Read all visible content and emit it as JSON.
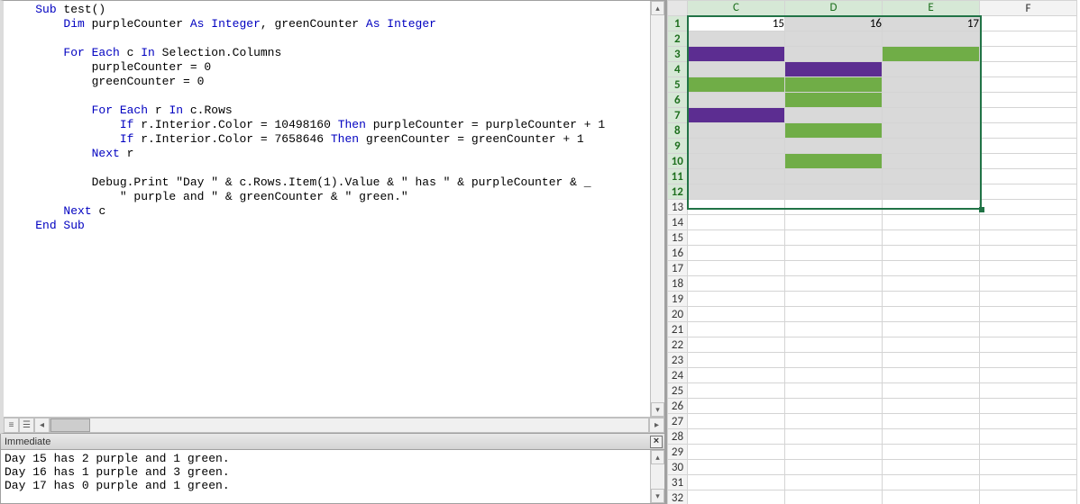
{
  "vba": {
    "code_tokens": [
      {
        "t": "    ",
        "kw": false
      },
      {
        "t": "Sub",
        "kw": true
      },
      {
        "t": " test()",
        "kw": false
      },
      {
        "t": "\n",
        "kw": false
      },
      {
        "t": "        ",
        "kw": false
      },
      {
        "t": "Dim",
        "kw": true
      },
      {
        "t": " purpleCounter ",
        "kw": false
      },
      {
        "t": "As Integer",
        "kw": true
      },
      {
        "t": ", greenCounter ",
        "kw": false
      },
      {
        "t": "As Integer",
        "kw": true
      },
      {
        "t": "\n",
        "kw": false
      },
      {
        "t": "\n",
        "kw": false
      },
      {
        "t": "        ",
        "kw": false
      },
      {
        "t": "For Each",
        "kw": true
      },
      {
        "t": " c ",
        "kw": false
      },
      {
        "t": "In",
        "kw": true
      },
      {
        "t": " Selection.Columns",
        "kw": false
      },
      {
        "t": "\n",
        "kw": false
      },
      {
        "t": "            purpleCounter = 0\n",
        "kw": false
      },
      {
        "t": "            greenCounter = 0\n",
        "kw": false
      },
      {
        "t": "\n",
        "kw": false
      },
      {
        "t": "            ",
        "kw": false
      },
      {
        "t": "For Each",
        "kw": true
      },
      {
        "t": " r ",
        "kw": false
      },
      {
        "t": "In",
        "kw": true
      },
      {
        "t": " c.Rows",
        "kw": false
      },
      {
        "t": "\n",
        "kw": false
      },
      {
        "t": "                ",
        "kw": false
      },
      {
        "t": "If",
        "kw": true
      },
      {
        "t": " r.Interior.Color = 10498160 ",
        "kw": false
      },
      {
        "t": "Then",
        "kw": true
      },
      {
        "t": " purpleCounter = purpleCounter + 1",
        "kw": false
      },
      {
        "t": "\n",
        "kw": false
      },
      {
        "t": "                ",
        "kw": false
      },
      {
        "t": "If",
        "kw": true
      },
      {
        "t": " r.Interior.Color = 7658646 ",
        "kw": false
      },
      {
        "t": "Then",
        "kw": true
      },
      {
        "t": " greenCounter = greenCounter + 1",
        "kw": false
      },
      {
        "t": "\n",
        "kw": false
      },
      {
        "t": "            ",
        "kw": false
      },
      {
        "t": "Next",
        "kw": true
      },
      {
        "t": " r",
        "kw": false
      },
      {
        "t": "\n",
        "kw": false
      },
      {
        "t": "\n",
        "kw": false
      },
      {
        "t": "            Debug.Print \"Day \" & c.Rows.Item(1).Value & \" has \" & purpleCounter & _\n",
        "kw": false
      },
      {
        "t": "                \" purple and \" & greenCounter & \" green.\"\n",
        "kw": false
      },
      {
        "t": "        ",
        "kw": false
      },
      {
        "t": "Next",
        "kw": true
      },
      {
        "t": " c",
        "kw": false
      },
      {
        "t": "\n",
        "kw": false
      },
      {
        "t": "    ",
        "kw": false
      },
      {
        "t": "End Sub",
        "kw": true
      },
      {
        "t": "\n",
        "kw": false
      }
    ]
  },
  "immediate": {
    "title": "Immediate",
    "lines": [
      "Day 15 has 2 purple and 1 green.",
      "Day 16 has 1 purple and 3 green.",
      "Day 17 has 0 purple and 1 green."
    ]
  },
  "sheet": {
    "columns": [
      "C",
      "D",
      "E",
      "F"
    ],
    "selected_cols": [
      "C",
      "D",
      "E"
    ],
    "selected_rows_from": 1,
    "selected_rows_to": 12,
    "row_count": 32,
    "row1": {
      "C": "15",
      "D": "16",
      "E": "17"
    },
    "fills": {
      "3": {
        "C": "purple",
        "E": "green"
      },
      "4": {
        "D": "purple"
      },
      "5": {
        "C": "green",
        "D": "green"
      },
      "6": {
        "D": "green"
      },
      "7": {
        "C": "purple"
      },
      "8": {
        "D": "green"
      },
      "10": {
        "D": "green"
      }
    },
    "active_cell": {
      "row": 1,
      "col": "C"
    }
  },
  "colors": {
    "purple_hex": "#5c2d91",
    "green_hex": "#70ad47",
    "selection_grey": "#d9d9d9"
  }
}
